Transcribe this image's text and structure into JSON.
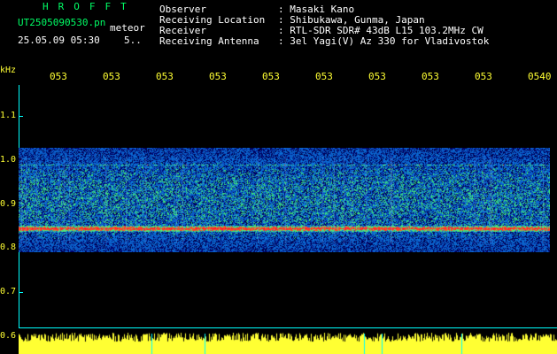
{
  "header": {
    "logo": "HROFFT",
    "filename": "UT2505090530.pn",
    "meteor_label": "meteor",
    "datetime": "25.05.09 05:30",
    "interval": "5..",
    "fields": [
      {
        "label": "Observer",
        "value": ": Masaki Kano"
      },
      {
        "label": "Receiving Location",
        "value": ": Shibukawa, Gunma, Japan"
      },
      {
        "label": "Receiver",
        "value": ": RTL-SDR SDR# 43dB L15 103.2MHz CW"
      },
      {
        "label": "Receiving Antenna",
        "value": ": 3el Yagi(V) Az 330 for Vladivostok"
      }
    ]
  },
  "axis": {
    "unit": "kHz",
    "y_labels": [
      "1.1",
      "1.0",
      "0.9",
      "0.8",
      "0.7",
      "0.6"
    ],
    "x_labels": [
      "053",
      "053",
      "053",
      "053",
      "053",
      "053",
      "053",
      "053",
      "053",
      "0540"
    ]
  },
  "spectrogram": {
    "freq_range_khz": [
      0.6,
      1.15
    ],
    "signal_band_khz": [
      0.78,
      1.02
    ],
    "carrier_line_khz": 0.845,
    "faint_line_khz": 0.99,
    "colors": {
      "background": "#000000",
      "noise": "#0a3aa8",
      "strong": "#00ffaa",
      "peak": "#ff3030",
      "axis": "#00ffff",
      "label": "#ffff33",
      "title": "#00ff66"
    }
  }
}
